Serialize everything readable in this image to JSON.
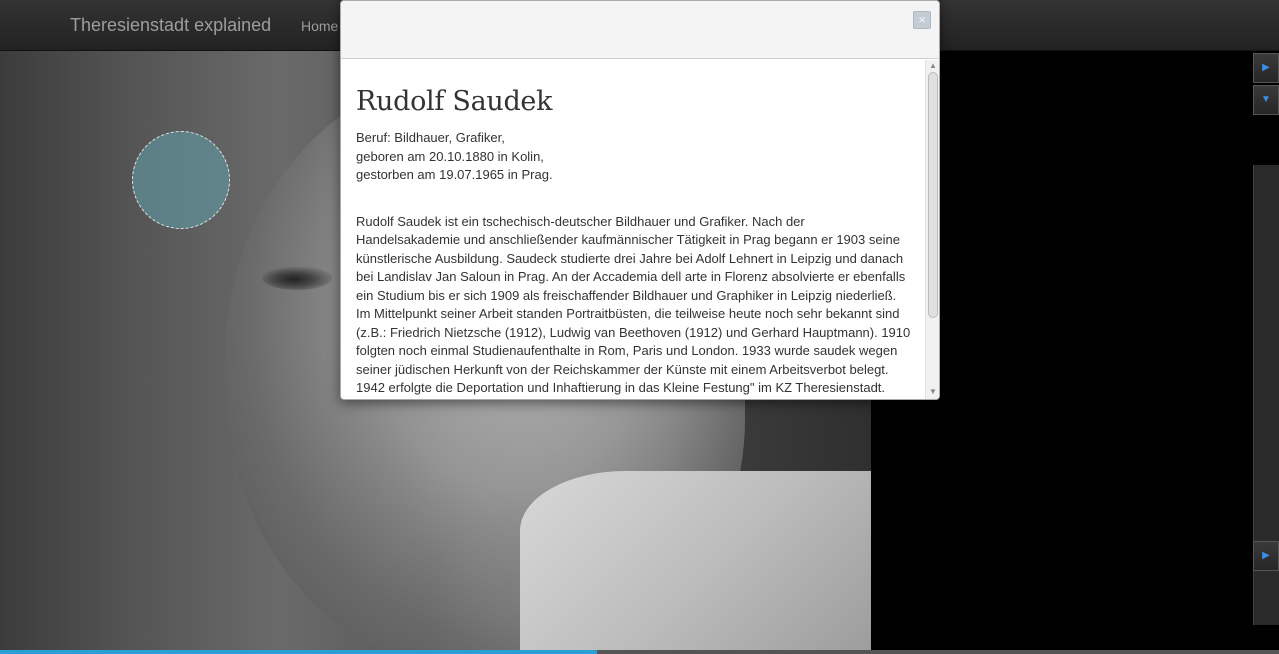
{
  "navbar": {
    "brand": "Theresienstadt explained",
    "items": [
      {
        "label": "Home"
      }
    ]
  },
  "modal": {
    "close_label": "×",
    "title": "Rudolf Saudek",
    "meta": [
      "Beruf: Bildhauer, Grafiker,",
      "geboren am 20.10.1880 in Kolin,",
      "gestorben am 19.07.1965 in Prag."
    ],
    "bio": "Rudolf Saudek ist ein tschechisch-deutscher Bildhauer und Grafiker. Nach der Handelsakademie und anschließender kaufmännischer Tätigkeit in Prag begann er 1903 seine künstlerische Ausbildung. Saudeck studierte drei Jahre bei Adolf Lehnert in Leipzig und danach bei Landislav Jan Saloun in Prag. An der Accademia dell arte in Florenz absolvierte er ebenfalls ein Studium bis er sich 1909 als freischaffender Bildhauer und Graphiker in Leipzig niederließ. Im Mittelpunkt seiner Arbeit standen Portraitbüsten, die teilweise heute noch sehr bekannt sind (z.B.: Friedrich Nietzsche (1912), Ludwig van Beethoven (1912) und Gerhard Hauptmann). 1910 folgten noch einmal Studienaufenthalte in Rom, Paris und London. 1933 wurde saudek wegen seiner jüdischen Herkunft von der Reichskammer der Künste mit einem Arbeitsverbot belegt. 1942 erfolgte die Deportation und Inhaftierung in das Kleine Festung\" im KZ Theresienstadt."
  },
  "side_controls": {
    "next_icon": "▶",
    "down_icon": "▼",
    "forward_icon": "▶"
  },
  "scrollbar": {
    "up_icon": "▲",
    "down_icon": "▼",
    "grip": "≡"
  },
  "progress": {
    "fraction": 0.467
  },
  "colors": {
    "navbar": "#222222",
    "accent": "#2a9fd6",
    "hotspot": "#5f96a0"
  },
  "icons": [
    "close-icon",
    "arrow-right-icon",
    "arrow-down-icon",
    "scroll-up-icon",
    "scroll-down-icon"
  ]
}
